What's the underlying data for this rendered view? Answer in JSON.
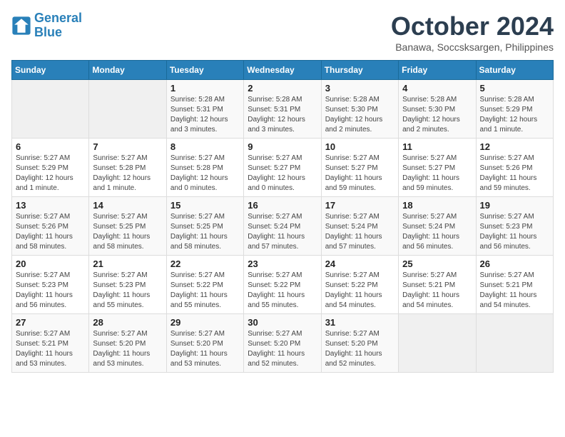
{
  "header": {
    "logo_line1": "General",
    "logo_line2": "Blue",
    "month_title": "October 2024",
    "location": "Banawa, Soccsksargen, Philippines"
  },
  "days_of_week": [
    "Sunday",
    "Monday",
    "Tuesday",
    "Wednesday",
    "Thursday",
    "Friday",
    "Saturday"
  ],
  "weeks": [
    [
      {
        "day": "",
        "info": ""
      },
      {
        "day": "",
        "info": ""
      },
      {
        "day": "1",
        "info": "Sunrise: 5:28 AM\nSunset: 5:31 PM\nDaylight: 12 hours and 3 minutes."
      },
      {
        "day": "2",
        "info": "Sunrise: 5:28 AM\nSunset: 5:31 PM\nDaylight: 12 hours and 3 minutes."
      },
      {
        "day": "3",
        "info": "Sunrise: 5:28 AM\nSunset: 5:30 PM\nDaylight: 12 hours and 2 minutes."
      },
      {
        "day": "4",
        "info": "Sunrise: 5:28 AM\nSunset: 5:30 PM\nDaylight: 12 hours and 2 minutes."
      },
      {
        "day": "5",
        "info": "Sunrise: 5:28 AM\nSunset: 5:29 PM\nDaylight: 12 hours and 1 minute."
      }
    ],
    [
      {
        "day": "6",
        "info": "Sunrise: 5:27 AM\nSunset: 5:29 PM\nDaylight: 12 hours and 1 minute."
      },
      {
        "day": "7",
        "info": "Sunrise: 5:27 AM\nSunset: 5:28 PM\nDaylight: 12 hours and 1 minute."
      },
      {
        "day": "8",
        "info": "Sunrise: 5:27 AM\nSunset: 5:28 PM\nDaylight: 12 hours and 0 minutes."
      },
      {
        "day": "9",
        "info": "Sunrise: 5:27 AM\nSunset: 5:27 PM\nDaylight: 12 hours and 0 minutes."
      },
      {
        "day": "10",
        "info": "Sunrise: 5:27 AM\nSunset: 5:27 PM\nDaylight: 11 hours and 59 minutes."
      },
      {
        "day": "11",
        "info": "Sunrise: 5:27 AM\nSunset: 5:27 PM\nDaylight: 11 hours and 59 minutes."
      },
      {
        "day": "12",
        "info": "Sunrise: 5:27 AM\nSunset: 5:26 PM\nDaylight: 11 hours and 59 minutes."
      }
    ],
    [
      {
        "day": "13",
        "info": "Sunrise: 5:27 AM\nSunset: 5:26 PM\nDaylight: 11 hours and 58 minutes."
      },
      {
        "day": "14",
        "info": "Sunrise: 5:27 AM\nSunset: 5:25 PM\nDaylight: 11 hours and 58 minutes."
      },
      {
        "day": "15",
        "info": "Sunrise: 5:27 AM\nSunset: 5:25 PM\nDaylight: 11 hours and 58 minutes."
      },
      {
        "day": "16",
        "info": "Sunrise: 5:27 AM\nSunset: 5:24 PM\nDaylight: 11 hours and 57 minutes."
      },
      {
        "day": "17",
        "info": "Sunrise: 5:27 AM\nSunset: 5:24 PM\nDaylight: 11 hours and 57 minutes."
      },
      {
        "day": "18",
        "info": "Sunrise: 5:27 AM\nSunset: 5:24 PM\nDaylight: 11 hours and 56 minutes."
      },
      {
        "day": "19",
        "info": "Sunrise: 5:27 AM\nSunset: 5:23 PM\nDaylight: 11 hours and 56 minutes."
      }
    ],
    [
      {
        "day": "20",
        "info": "Sunrise: 5:27 AM\nSunset: 5:23 PM\nDaylight: 11 hours and 56 minutes."
      },
      {
        "day": "21",
        "info": "Sunrise: 5:27 AM\nSunset: 5:23 PM\nDaylight: 11 hours and 55 minutes."
      },
      {
        "day": "22",
        "info": "Sunrise: 5:27 AM\nSunset: 5:22 PM\nDaylight: 11 hours and 55 minutes."
      },
      {
        "day": "23",
        "info": "Sunrise: 5:27 AM\nSunset: 5:22 PM\nDaylight: 11 hours and 55 minutes."
      },
      {
        "day": "24",
        "info": "Sunrise: 5:27 AM\nSunset: 5:22 PM\nDaylight: 11 hours and 54 minutes."
      },
      {
        "day": "25",
        "info": "Sunrise: 5:27 AM\nSunset: 5:21 PM\nDaylight: 11 hours and 54 minutes."
      },
      {
        "day": "26",
        "info": "Sunrise: 5:27 AM\nSunset: 5:21 PM\nDaylight: 11 hours and 54 minutes."
      }
    ],
    [
      {
        "day": "27",
        "info": "Sunrise: 5:27 AM\nSunset: 5:21 PM\nDaylight: 11 hours and 53 minutes."
      },
      {
        "day": "28",
        "info": "Sunrise: 5:27 AM\nSunset: 5:20 PM\nDaylight: 11 hours and 53 minutes."
      },
      {
        "day": "29",
        "info": "Sunrise: 5:27 AM\nSunset: 5:20 PM\nDaylight: 11 hours and 53 minutes."
      },
      {
        "day": "30",
        "info": "Sunrise: 5:27 AM\nSunset: 5:20 PM\nDaylight: 11 hours and 52 minutes."
      },
      {
        "day": "31",
        "info": "Sunrise: 5:27 AM\nSunset: 5:20 PM\nDaylight: 11 hours and 52 minutes."
      },
      {
        "day": "",
        "info": ""
      },
      {
        "day": "",
        "info": ""
      }
    ]
  ]
}
